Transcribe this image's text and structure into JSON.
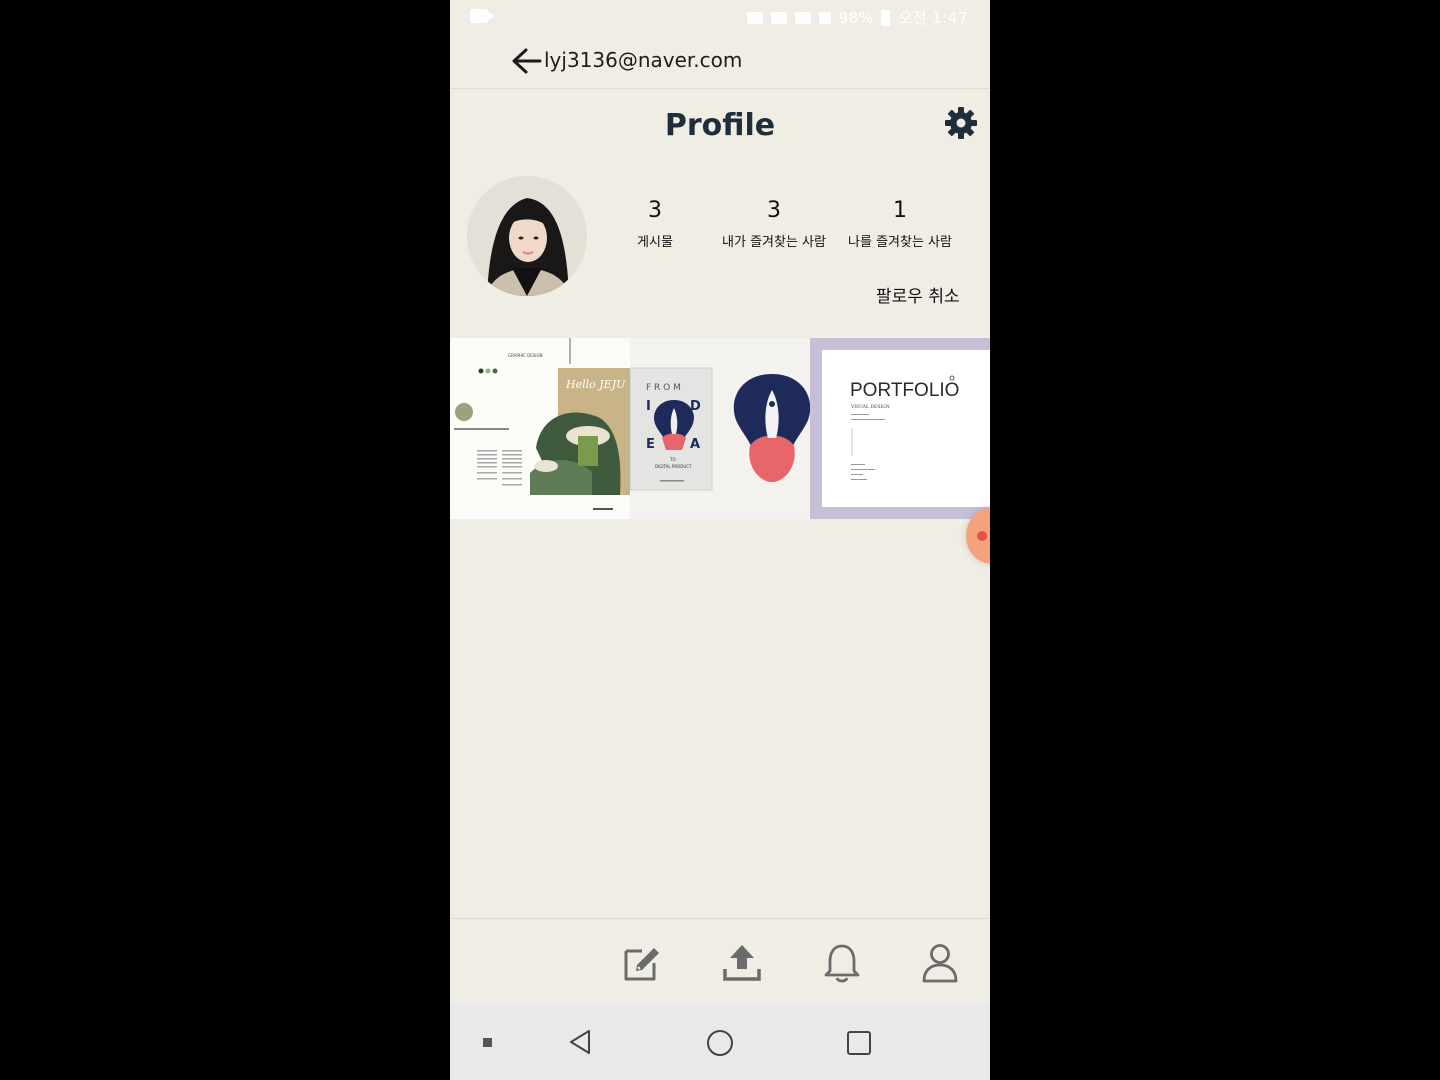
{
  "status_bar": {
    "battery": "98%",
    "time": "오전 1:47"
  },
  "header": {
    "email": "lyj3136@naver.com",
    "title": "Profile"
  },
  "profile": {
    "stats": [
      {
        "value": "3",
        "label": "게시물"
      },
      {
        "value": "3",
        "label": "내가 즐겨찾는 사람"
      },
      {
        "value": "1",
        "label": "나를 즐겨찾는 사람"
      }
    ],
    "unfollow_label": "팔로우 취소"
  },
  "posts": [
    {
      "heading": "GRAPHIC DESIGN",
      "title": "Hello JEJU"
    },
    {
      "words": [
        "F R O M",
        "I",
        "D",
        "E",
        "A",
        "TO",
        "DIGITAL PRODUCT"
      ]
    },
    {
      "title": "PORTFOLIO",
      "subtitle": "VISUAL DESIGN"
    }
  ],
  "colors": {
    "background": "#efede4",
    "text_dark": "#1f2e3a",
    "nav_icon": "#6b6b6b",
    "accent_orange": "#f6a27c",
    "accent_red": "#e2544c"
  },
  "icons": {
    "bottom_nav": [
      "edit-icon",
      "upload-icon",
      "bell-icon",
      "user-icon"
    ],
    "system_nav": [
      "back-triangle-icon",
      "home-circle-icon",
      "recents-square-icon"
    ]
  }
}
